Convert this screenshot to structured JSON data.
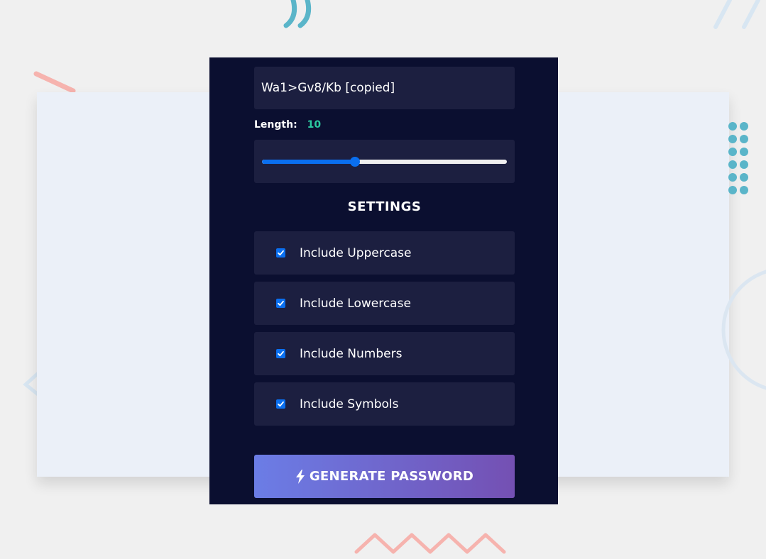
{
  "generator": {
    "result": "Wa1>Gv8/Kb [copied]",
    "length_label": "Length:",
    "length_value": "10",
    "length_fraction": 0.38,
    "settings_title": "SETTINGS",
    "settings": [
      {
        "label": "Include Uppercase",
        "checked": true
      },
      {
        "label": "Include Lowercase",
        "checked": true
      },
      {
        "label": "Include Numbers",
        "checked": true
      },
      {
        "label": "Include Symbols",
        "checked": true
      }
    ],
    "generate_label": "GENERATE PASSWORD",
    "generate_icon": "bolt-icon"
  },
  "colors": {
    "page_background": "#f0f0f0",
    "panel_background": "#0b0f30",
    "field_background": "#1c1f40",
    "accent_blue": "#0a6ff0",
    "length_value": "#2bc9a0",
    "button_gradient_start": "#6b7de6",
    "button_gradient_end": "#7450b3"
  }
}
